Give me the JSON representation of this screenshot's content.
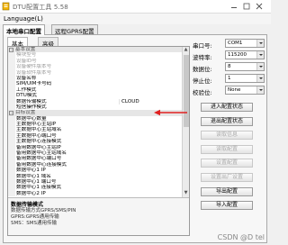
{
  "app": {
    "title": "DTU配置工具 5.58"
  },
  "menu": {
    "language": "Language(L)"
  },
  "tabs": [
    {
      "label": "本地串口配置"
    },
    {
      "label": "远程GPRS配置"
    }
  ],
  "subtabs": [
    {
      "label": "基本"
    },
    {
      "label": "高级"
    }
  ],
  "property_rows": [
    {
      "type": "category",
      "name": "基本设置"
    },
    {
      "type": "item",
      "state": "disabled",
      "name": "模块型号",
      "value": ""
    },
    {
      "type": "item",
      "state": "disabled",
      "name": "设备ID号",
      "value": ""
    },
    {
      "type": "item",
      "state": "disabled",
      "name": "设备硬件版本号",
      "value": ""
    },
    {
      "type": "item",
      "state": "disabled",
      "name": "设备软件版本号",
      "value": ""
    },
    {
      "type": "item",
      "state": "normal",
      "name": "设备名称",
      "value": ""
    },
    {
      "type": "item",
      "state": "normal",
      "name": "SIM/UIM卡号码",
      "value": ""
    },
    {
      "type": "item",
      "state": "normal",
      "name": "工作模式",
      "value": ""
    },
    {
      "type": "item",
      "state": "normal",
      "name": "DTU模式",
      "value": ""
    },
    {
      "type": "item",
      "state": "selected",
      "name": "数据传输模式",
      "value": "CLOUD"
    },
    {
      "type": "item",
      "state": "normal",
      "name": "短信操作模式",
      "value": ""
    },
    {
      "type": "category",
      "name": "目标设置"
    },
    {
      "type": "item",
      "state": "normal",
      "name": "数据中心数量",
      "value": ""
    },
    {
      "type": "item",
      "state": "normal",
      "name": "主数据中心主站IP",
      "value": ""
    },
    {
      "type": "item",
      "state": "normal",
      "name": "主数据中心主站域名",
      "value": ""
    },
    {
      "type": "item",
      "state": "normal",
      "name": "主数据中心端口号",
      "value": ""
    },
    {
      "type": "item",
      "state": "normal",
      "name": "主数据中心连接模式",
      "value": ""
    },
    {
      "type": "item",
      "state": "normal",
      "name": "备用数据中心主站IP",
      "value": ""
    },
    {
      "type": "item",
      "state": "normal",
      "name": "备用数据中心主站域名",
      "value": ""
    },
    {
      "type": "item",
      "state": "normal",
      "name": "备用数据中心端口号",
      "value": ""
    },
    {
      "type": "item",
      "state": "normal",
      "name": "备用数据中心连接模式",
      "value": ""
    },
    {
      "type": "item",
      "state": "normal",
      "name": "数据中心1 IP",
      "value": ""
    },
    {
      "type": "item",
      "state": "normal",
      "name": "数据中心1 域名",
      "value": ""
    },
    {
      "type": "item",
      "state": "normal",
      "name": "数据中心1 端口号",
      "value": ""
    },
    {
      "type": "item",
      "state": "normal",
      "name": "数据中心1 连接模式",
      "value": ""
    },
    {
      "type": "item",
      "state": "normal",
      "name": "数据中心2 IP",
      "value": ""
    }
  ],
  "description": {
    "title": "数据传输模式",
    "lines": [
      "数据传输方式GPRS/SMS/PIN",
      "GPRS:GPRS通用传输",
      "SMS：SMS通用传输"
    ]
  },
  "settings": [
    {
      "label": "串口号:",
      "value": "COM1"
    },
    {
      "label": "波特率:",
      "value": "115200"
    },
    {
      "label": "数据位:",
      "value": "8"
    },
    {
      "label": "停止位:",
      "value": "1"
    },
    {
      "label": "校验位:",
      "value": "None"
    }
  ],
  "buttons": [
    {
      "label": "进入配置状态",
      "enabled": true
    },
    {
      "label": "退出配置状态",
      "enabled": true
    },
    {
      "label": "读取信息",
      "enabled": false
    },
    {
      "label": "读取配置",
      "enabled": false
    },
    {
      "label": "设置配置",
      "enabled": false
    },
    {
      "label": "设置出厂设置",
      "enabled": false
    },
    {
      "label": "导出配置",
      "enabled": true
    },
    {
      "label": "导入配置",
      "enabled": true
    }
  ],
  "watermark": "CSDN @D tel"
}
